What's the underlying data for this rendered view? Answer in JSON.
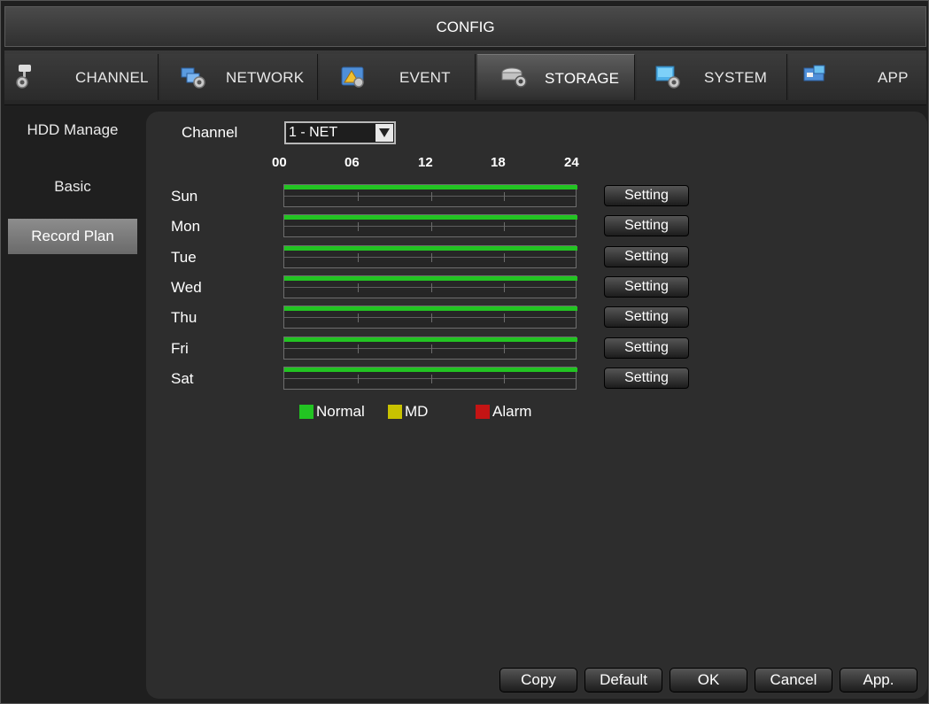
{
  "window": {
    "title": "CONFIG"
  },
  "tabs": [
    {
      "label": "CHANNEL",
      "icon": "channel-camera-icon"
    },
    {
      "label": "NETWORK",
      "icon": "network-icon"
    },
    {
      "label": "EVENT",
      "icon": "event-icon"
    },
    {
      "label": "STORAGE",
      "icon": "storage-icon",
      "active": true
    },
    {
      "label": "SYSTEM",
      "icon": "system-icon"
    },
    {
      "label": "APP",
      "icon": "app-icon"
    }
  ],
  "sidebar": {
    "items": [
      {
        "label": "HDD Manage"
      },
      {
        "label": "Basic"
      },
      {
        "label": "Record Plan",
        "active": true
      }
    ]
  },
  "channel": {
    "label": "Channel",
    "value": "1 - NET"
  },
  "schedule": {
    "hours": [
      "00",
      "06",
      "12",
      "18",
      "24"
    ],
    "days": [
      {
        "name": "Sun",
        "normal_coverage": 1.0,
        "button": "Setting"
      },
      {
        "name": "Mon",
        "normal_coverage": 1.0,
        "button": "Setting"
      },
      {
        "name": "Tue",
        "normal_coverage": 1.0,
        "button": "Setting"
      },
      {
        "name": "Wed",
        "normal_coverage": 1.0,
        "button": "Setting"
      },
      {
        "name": "Thu",
        "normal_coverage": 1.0,
        "button": "Setting"
      },
      {
        "name": "Fri",
        "normal_coverage": 1.0,
        "button": "Setting"
      },
      {
        "name": "Sat",
        "normal_coverage": 1.0,
        "button": "Setting"
      }
    ]
  },
  "legend": [
    {
      "label": "Normal",
      "color": "#22c422"
    },
    {
      "label": "MD",
      "color": "#c8c200"
    },
    {
      "label": "Alarm",
      "color": "#c41414"
    }
  ],
  "footer": {
    "copy": "Copy",
    "default": "Default",
    "ok": "OK",
    "cancel": "Cancel",
    "apply": "App."
  }
}
